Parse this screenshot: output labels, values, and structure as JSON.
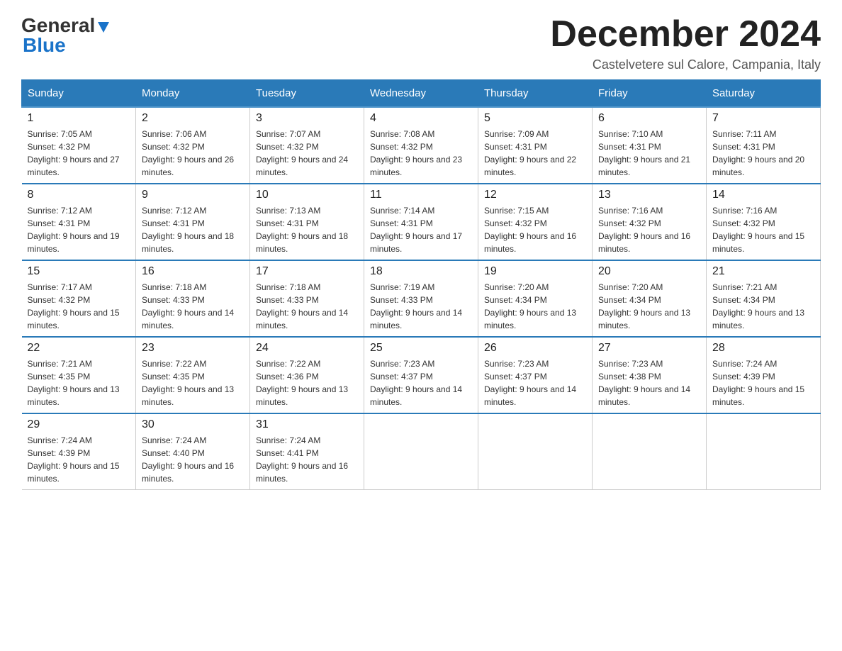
{
  "header": {
    "logo_general": "General",
    "logo_blue": "Blue",
    "month_title": "December 2024",
    "location": "Castelvetere sul Calore, Campania, Italy"
  },
  "days_of_week": [
    "Sunday",
    "Monday",
    "Tuesday",
    "Wednesday",
    "Thursday",
    "Friday",
    "Saturday"
  ],
  "weeks": [
    [
      {
        "day": "1",
        "sunrise": "Sunrise: 7:05 AM",
        "sunset": "Sunset: 4:32 PM",
        "daylight": "Daylight: 9 hours and 27 minutes."
      },
      {
        "day": "2",
        "sunrise": "Sunrise: 7:06 AM",
        "sunset": "Sunset: 4:32 PM",
        "daylight": "Daylight: 9 hours and 26 minutes."
      },
      {
        "day": "3",
        "sunrise": "Sunrise: 7:07 AM",
        "sunset": "Sunset: 4:32 PM",
        "daylight": "Daylight: 9 hours and 24 minutes."
      },
      {
        "day": "4",
        "sunrise": "Sunrise: 7:08 AM",
        "sunset": "Sunset: 4:32 PM",
        "daylight": "Daylight: 9 hours and 23 minutes."
      },
      {
        "day": "5",
        "sunrise": "Sunrise: 7:09 AM",
        "sunset": "Sunset: 4:31 PM",
        "daylight": "Daylight: 9 hours and 22 minutes."
      },
      {
        "day": "6",
        "sunrise": "Sunrise: 7:10 AM",
        "sunset": "Sunset: 4:31 PM",
        "daylight": "Daylight: 9 hours and 21 minutes."
      },
      {
        "day": "7",
        "sunrise": "Sunrise: 7:11 AM",
        "sunset": "Sunset: 4:31 PM",
        "daylight": "Daylight: 9 hours and 20 minutes."
      }
    ],
    [
      {
        "day": "8",
        "sunrise": "Sunrise: 7:12 AM",
        "sunset": "Sunset: 4:31 PM",
        "daylight": "Daylight: 9 hours and 19 minutes."
      },
      {
        "day": "9",
        "sunrise": "Sunrise: 7:12 AM",
        "sunset": "Sunset: 4:31 PM",
        "daylight": "Daylight: 9 hours and 18 minutes."
      },
      {
        "day": "10",
        "sunrise": "Sunrise: 7:13 AM",
        "sunset": "Sunset: 4:31 PM",
        "daylight": "Daylight: 9 hours and 18 minutes."
      },
      {
        "day": "11",
        "sunrise": "Sunrise: 7:14 AM",
        "sunset": "Sunset: 4:31 PM",
        "daylight": "Daylight: 9 hours and 17 minutes."
      },
      {
        "day": "12",
        "sunrise": "Sunrise: 7:15 AM",
        "sunset": "Sunset: 4:32 PM",
        "daylight": "Daylight: 9 hours and 16 minutes."
      },
      {
        "day": "13",
        "sunrise": "Sunrise: 7:16 AM",
        "sunset": "Sunset: 4:32 PM",
        "daylight": "Daylight: 9 hours and 16 minutes."
      },
      {
        "day": "14",
        "sunrise": "Sunrise: 7:16 AM",
        "sunset": "Sunset: 4:32 PM",
        "daylight": "Daylight: 9 hours and 15 minutes."
      }
    ],
    [
      {
        "day": "15",
        "sunrise": "Sunrise: 7:17 AM",
        "sunset": "Sunset: 4:32 PM",
        "daylight": "Daylight: 9 hours and 15 minutes."
      },
      {
        "day": "16",
        "sunrise": "Sunrise: 7:18 AM",
        "sunset": "Sunset: 4:33 PM",
        "daylight": "Daylight: 9 hours and 14 minutes."
      },
      {
        "day": "17",
        "sunrise": "Sunrise: 7:18 AM",
        "sunset": "Sunset: 4:33 PM",
        "daylight": "Daylight: 9 hours and 14 minutes."
      },
      {
        "day": "18",
        "sunrise": "Sunrise: 7:19 AM",
        "sunset": "Sunset: 4:33 PM",
        "daylight": "Daylight: 9 hours and 14 minutes."
      },
      {
        "day": "19",
        "sunrise": "Sunrise: 7:20 AM",
        "sunset": "Sunset: 4:34 PM",
        "daylight": "Daylight: 9 hours and 13 minutes."
      },
      {
        "day": "20",
        "sunrise": "Sunrise: 7:20 AM",
        "sunset": "Sunset: 4:34 PM",
        "daylight": "Daylight: 9 hours and 13 minutes."
      },
      {
        "day": "21",
        "sunrise": "Sunrise: 7:21 AM",
        "sunset": "Sunset: 4:34 PM",
        "daylight": "Daylight: 9 hours and 13 minutes."
      }
    ],
    [
      {
        "day": "22",
        "sunrise": "Sunrise: 7:21 AM",
        "sunset": "Sunset: 4:35 PM",
        "daylight": "Daylight: 9 hours and 13 minutes."
      },
      {
        "day": "23",
        "sunrise": "Sunrise: 7:22 AM",
        "sunset": "Sunset: 4:35 PM",
        "daylight": "Daylight: 9 hours and 13 minutes."
      },
      {
        "day": "24",
        "sunrise": "Sunrise: 7:22 AM",
        "sunset": "Sunset: 4:36 PM",
        "daylight": "Daylight: 9 hours and 13 minutes."
      },
      {
        "day": "25",
        "sunrise": "Sunrise: 7:23 AM",
        "sunset": "Sunset: 4:37 PM",
        "daylight": "Daylight: 9 hours and 14 minutes."
      },
      {
        "day": "26",
        "sunrise": "Sunrise: 7:23 AM",
        "sunset": "Sunset: 4:37 PM",
        "daylight": "Daylight: 9 hours and 14 minutes."
      },
      {
        "day": "27",
        "sunrise": "Sunrise: 7:23 AM",
        "sunset": "Sunset: 4:38 PM",
        "daylight": "Daylight: 9 hours and 14 minutes."
      },
      {
        "day": "28",
        "sunrise": "Sunrise: 7:24 AM",
        "sunset": "Sunset: 4:39 PM",
        "daylight": "Daylight: 9 hours and 15 minutes."
      }
    ],
    [
      {
        "day": "29",
        "sunrise": "Sunrise: 7:24 AM",
        "sunset": "Sunset: 4:39 PM",
        "daylight": "Daylight: 9 hours and 15 minutes."
      },
      {
        "day": "30",
        "sunrise": "Sunrise: 7:24 AM",
        "sunset": "Sunset: 4:40 PM",
        "daylight": "Daylight: 9 hours and 16 minutes."
      },
      {
        "day": "31",
        "sunrise": "Sunrise: 7:24 AM",
        "sunset": "Sunset: 4:41 PM",
        "daylight": "Daylight: 9 hours and 16 minutes."
      },
      null,
      null,
      null,
      null
    ]
  ]
}
